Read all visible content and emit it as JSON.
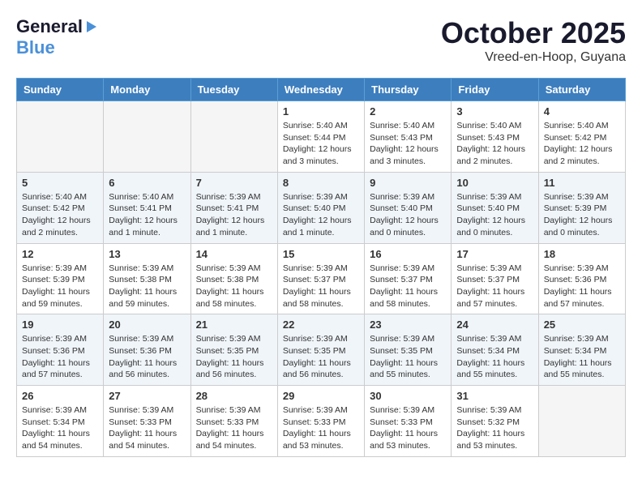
{
  "header": {
    "logo_general": "General",
    "logo_blue": "Blue",
    "month_title": "October 2025",
    "location": "Vreed-en-Hoop, Guyana"
  },
  "days_of_week": [
    "Sunday",
    "Monday",
    "Tuesday",
    "Wednesday",
    "Thursday",
    "Friday",
    "Saturday"
  ],
  "weeks": [
    [
      {
        "day": "",
        "info": ""
      },
      {
        "day": "",
        "info": ""
      },
      {
        "day": "",
        "info": ""
      },
      {
        "day": "1",
        "info": "Sunrise: 5:40 AM\nSunset: 5:44 PM\nDaylight: 12 hours\nand 3 minutes."
      },
      {
        "day": "2",
        "info": "Sunrise: 5:40 AM\nSunset: 5:43 PM\nDaylight: 12 hours\nand 3 minutes."
      },
      {
        "day": "3",
        "info": "Sunrise: 5:40 AM\nSunset: 5:43 PM\nDaylight: 12 hours\nand 2 minutes."
      },
      {
        "day": "4",
        "info": "Sunrise: 5:40 AM\nSunset: 5:42 PM\nDaylight: 12 hours\nand 2 minutes."
      }
    ],
    [
      {
        "day": "5",
        "info": "Sunrise: 5:40 AM\nSunset: 5:42 PM\nDaylight: 12 hours\nand 2 minutes."
      },
      {
        "day": "6",
        "info": "Sunrise: 5:40 AM\nSunset: 5:41 PM\nDaylight: 12 hours\nand 1 minute."
      },
      {
        "day": "7",
        "info": "Sunrise: 5:39 AM\nSunset: 5:41 PM\nDaylight: 12 hours\nand 1 minute."
      },
      {
        "day": "8",
        "info": "Sunrise: 5:39 AM\nSunset: 5:40 PM\nDaylight: 12 hours\nand 1 minute."
      },
      {
        "day": "9",
        "info": "Sunrise: 5:39 AM\nSunset: 5:40 PM\nDaylight: 12 hours\nand 0 minutes."
      },
      {
        "day": "10",
        "info": "Sunrise: 5:39 AM\nSunset: 5:40 PM\nDaylight: 12 hours\nand 0 minutes."
      },
      {
        "day": "11",
        "info": "Sunrise: 5:39 AM\nSunset: 5:39 PM\nDaylight: 12 hours\nand 0 minutes."
      }
    ],
    [
      {
        "day": "12",
        "info": "Sunrise: 5:39 AM\nSunset: 5:39 PM\nDaylight: 11 hours\nand 59 minutes."
      },
      {
        "day": "13",
        "info": "Sunrise: 5:39 AM\nSunset: 5:38 PM\nDaylight: 11 hours\nand 59 minutes."
      },
      {
        "day": "14",
        "info": "Sunrise: 5:39 AM\nSunset: 5:38 PM\nDaylight: 11 hours\nand 58 minutes."
      },
      {
        "day": "15",
        "info": "Sunrise: 5:39 AM\nSunset: 5:37 PM\nDaylight: 11 hours\nand 58 minutes."
      },
      {
        "day": "16",
        "info": "Sunrise: 5:39 AM\nSunset: 5:37 PM\nDaylight: 11 hours\nand 58 minutes."
      },
      {
        "day": "17",
        "info": "Sunrise: 5:39 AM\nSunset: 5:37 PM\nDaylight: 11 hours\nand 57 minutes."
      },
      {
        "day": "18",
        "info": "Sunrise: 5:39 AM\nSunset: 5:36 PM\nDaylight: 11 hours\nand 57 minutes."
      }
    ],
    [
      {
        "day": "19",
        "info": "Sunrise: 5:39 AM\nSunset: 5:36 PM\nDaylight: 11 hours\nand 57 minutes."
      },
      {
        "day": "20",
        "info": "Sunrise: 5:39 AM\nSunset: 5:36 PM\nDaylight: 11 hours\nand 56 minutes."
      },
      {
        "day": "21",
        "info": "Sunrise: 5:39 AM\nSunset: 5:35 PM\nDaylight: 11 hours\nand 56 minutes."
      },
      {
        "day": "22",
        "info": "Sunrise: 5:39 AM\nSunset: 5:35 PM\nDaylight: 11 hours\nand 56 minutes."
      },
      {
        "day": "23",
        "info": "Sunrise: 5:39 AM\nSunset: 5:35 PM\nDaylight: 11 hours\nand 55 minutes."
      },
      {
        "day": "24",
        "info": "Sunrise: 5:39 AM\nSunset: 5:34 PM\nDaylight: 11 hours\nand 55 minutes."
      },
      {
        "day": "25",
        "info": "Sunrise: 5:39 AM\nSunset: 5:34 PM\nDaylight: 11 hours\nand 55 minutes."
      }
    ],
    [
      {
        "day": "26",
        "info": "Sunrise: 5:39 AM\nSunset: 5:34 PM\nDaylight: 11 hours\nand 54 minutes."
      },
      {
        "day": "27",
        "info": "Sunrise: 5:39 AM\nSunset: 5:33 PM\nDaylight: 11 hours\nand 54 minutes."
      },
      {
        "day": "28",
        "info": "Sunrise: 5:39 AM\nSunset: 5:33 PM\nDaylight: 11 hours\nand 54 minutes."
      },
      {
        "day": "29",
        "info": "Sunrise: 5:39 AM\nSunset: 5:33 PM\nDaylight: 11 hours\nand 53 minutes."
      },
      {
        "day": "30",
        "info": "Sunrise: 5:39 AM\nSunset: 5:33 PM\nDaylight: 11 hours\nand 53 minutes."
      },
      {
        "day": "31",
        "info": "Sunrise: 5:39 AM\nSunset: 5:32 PM\nDaylight: 11 hours\nand 53 minutes."
      },
      {
        "day": "",
        "info": ""
      }
    ]
  ]
}
